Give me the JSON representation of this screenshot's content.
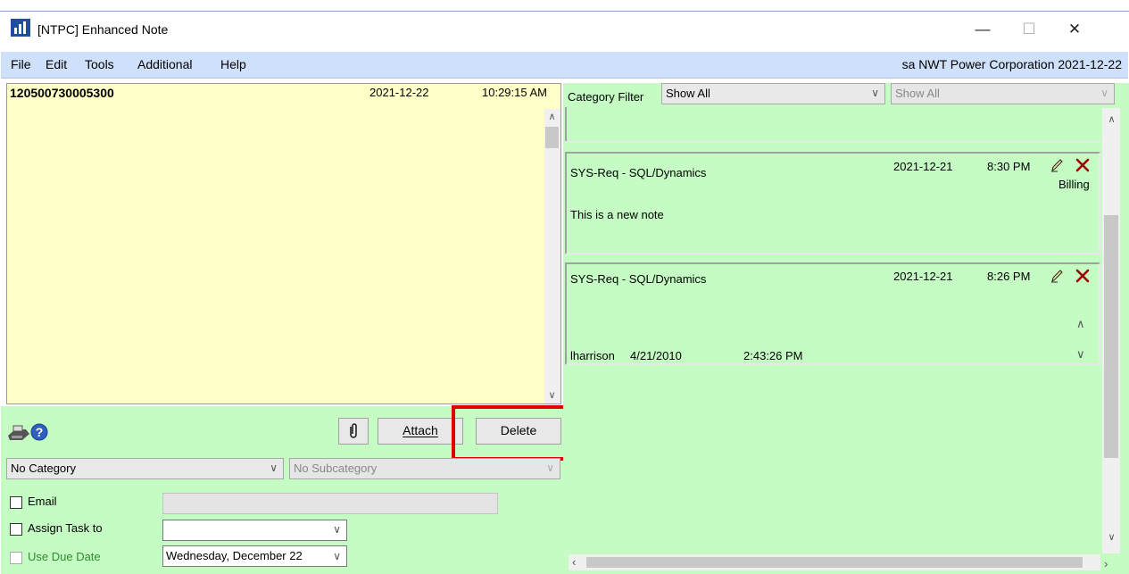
{
  "window": {
    "title": "[NTPC] Enhanced Note",
    "minimize": "—",
    "maximize": "☐",
    "close": "✕"
  },
  "menu": {
    "items": [
      "File",
      "Edit",
      "Tools",
      "Additional",
      "Help"
    ],
    "user_info": "sa  NWT Power Corporation  2021-12-22"
  },
  "note": {
    "id": "120500730005300",
    "date": "2021-12-22",
    "time": "10:29:15 AM",
    "body": ""
  },
  "buttons": {
    "attach": "Attach",
    "delete": "Delete"
  },
  "category": {
    "selected": "No Category",
    "subcategory": "No Subcategory"
  },
  "options": {
    "email_label": "Email",
    "email_value": "",
    "assign_label": "Assign Task to",
    "assign_value": "",
    "due_label": "Use Due Date",
    "due_value": "Wednesday, December 22"
  },
  "filter": {
    "label": "Category Filter",
    "value": "Show All",
    "sub_value": "Show All"
  },
  "notes_list": [
    {
      "category": "SYS-Req - SQL/Dynamics",
      "date": "2021-12-21",
      "time": "8:30 PM",
      "tag": "Billing",
      "text": "This is a new note"
    },
    {
      "category": "SYS-Req - SQL/Dynamics",
      "date": "2021-12-21",
      "time": "8:26 PM",
      "user": "lharrison",
      "user_date": "4/21/2010",
      "user_time": "2:43:26 PM"
    }
  ],
  "colors": {
    "note_bg": "#ffffc8",
    "panel_bg": "#c4fcc4",
    "menu_bg": "#cfe0fb",
    "highlight": "#e00000"
  }
}
